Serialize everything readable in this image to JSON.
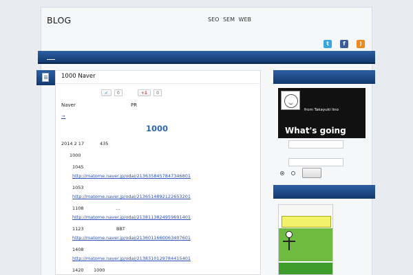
{
  "header": {
    "site_title": "BLOG",
    "tagline": "SEO SEM WEB",
    "social": [
      "twitter-icon",
      "facebook-icon",
      "rss-icon"
    ]
  },
  "nav": {
    "items": [
      {
        "label": ""
      },
      {
        "label": ""
      },
      {
        "label": ""
      },
      {
        "label": ""
      }
    ]
  },
  "post": {
    "title": "1000 Naver",
    "share": {
      "tweet_count": "0",
      "gplus_label": "+1",
      "gplus_count": "0"
    },
    "naver_text": "Naver",
    "pr_text": "PR",
    "arrow_link": "→",
    "big_number": "1000",
    "date_line": "2014 2 17",
    "views": "435",
    "entries": [
      {
        "label": "1000",
        "url": ""
      },
      {
        "label": "1045",
        "url": "http://matome.naver.jp/odai/2136358457847346801"
      },
      {
        "label": "1053",
        "url": "http://matome.naver.jp/odai/2136514892122653201"
      },
      {
        "label": "1108",
        "suffix": "…",
        "url": "http://matome.naver.jp/odai/2138113824959691401"
      },
      {
        "label": "1123",
        "suffix": "BBT",
        "url": "http://matome.naver.jp/odai/2136011660063407601"
      },
      {
        "label": "1408",
        "url": "http://matome.naver.jp/odai/2138310129784415401"
      },
      {
        "label": "1420",
        "suffix": "1000",
        "url": ""
      }
    ]
  },
  "sidebar": {
    "twitter_heading": "",
    "twitter_widget": {
      "title": "",
      "from": "from Takayuki Iino",
      "headline": "What's going"
    },
    "search_button": "",
    "book_heading": "",
    "book": {
      "top_text": "",
      "bottom_text": ""
    }
  },
  "colors": {
    "nav_bg": "#1d4a88",
    "link": "#2b4fb8",
    "accent_number": "#2a66b5"
  }
}
